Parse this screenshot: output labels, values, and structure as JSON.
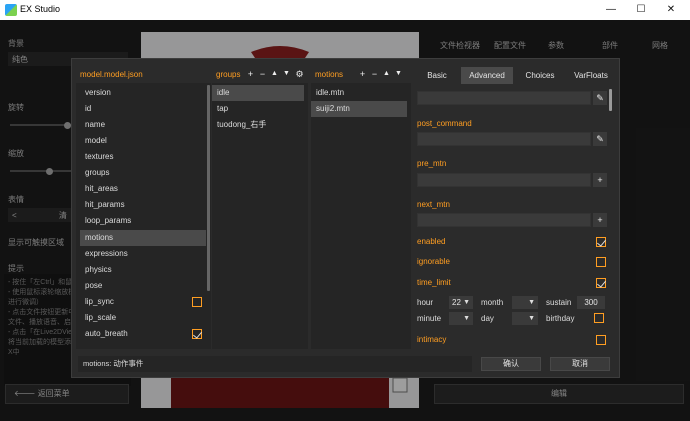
{
  "window": {
    "title": "EX Studio",
    "minimize": "—",
    "maximize": "☐",
    "close": "✕"
  },
  "background": {
    "left_labels": [
      "背景",
      "旋转",
      "缩放",
      "表情",
      "显示可触摸区域",
      "提示"
    ],
    "bg_select_value": "纯色",
    "expr_value": "清",
    "hints": [
      "- 按住「左Ctrl」和鼠...",
      "- 使用鼠标滚轮缩放模型",
      "进行微调）",
      "- 点击文件按钮更新中",
      "文件、播放语音、启用",
      "- 点击「在Live2DViewer",
      "将当前加载的模型添",
      "X中"
    ],
    "back_button": "返回菜单",
    "right_tabs": [
      "文件检视器",
      "配置文件",
      "参数",
      "部件",
      "网格"
    ],
    "edit_button": "编辑"
  },
  "dialog": {
    "model_column": {
      "title": "model.model.json",
      "items": [
        {
          "label": "version"
        },
        {
          "label": "id"
        },
        {
          "label": "name"
        },
        {
          "label": "model"
        },
        {
          "label": "textures"
        },
        {
          "label": "groups"
        },
        {
          "label": "hit_areas"
        },
        {
          "label": "hit_params"
        },
        {
          "label": "loop_params"
        },
        {
          "label": "motions",
          "selected": true
        },
        {
          "label": "expressions"
        },
        {
          "label": "physics"
        },
        {
          "label": "pose"
        },
        {
          "label": "lip_sync",
          "checkbox": true,
          "checked": false
        },
        {
          "label": "lip_scale"
        },
        {
          "label": "auto_breath",
          "checkbox": true,
          "checked": true
        }
      ]
    },
    "groups_column": {
      "title": "groups",
      "items": [
        {
          "label": "idle",
          "selected": true
        },
        {
          "label": "tap"
        },
        {
          "label": "tuodong_右手"
        }
      ]
    },
    "motions_column": {
      "title": "motions",
      "items": [
        {
          "label": "idle.mtn"
        },
        {
          "label": "suiji2.mtn",
          "selected": true
        }
      ]
    },
    "tabs": [
      {
        "label": "Basic"
      },
      {
        "label": "Advanced",
        "active": true
      },
      {
        "label": "Choices"
      },
      {
        "label": "VarFloats"
      }
    ],
    "advanced": {
      "post_command_label": "post_command",
      "pre_mtn_label": "pre_mtn",
      "next_mtn_label": "next_mtn",
      "enabled_label": "enabled",
      "enabled": true,
      "ignorable_label": "ignorable",
      "ignorable": false,
      "time_limit_label": "time_limit",
      "time_limit": true,
      "hour_label": "hour",
      "hour_value": "22",
      "month_label": "month",
      "month_value": "",
      "sustain_label": "sustain",
      "sustain_value": "300",
      "minute_label": "minute",
      "minute_value": "",
      "day_label": "day",
      "day_value": "",
      "birthday_label": "birthday",
      "birthday": false,
      "intimacy_label": "intimacy",
      "intimacy": false
    },
    "status_text": "motions: 动作事件",
    "ok_button": "确认",
    "cancel_button": "取消"
  },
  "colors": {
    "accent": "#ff9e22",
    "dialog_bg": "#2b2b2b",
    "list_bg": "#252525",
    "selection": "#4a4a4a"
  }
}
